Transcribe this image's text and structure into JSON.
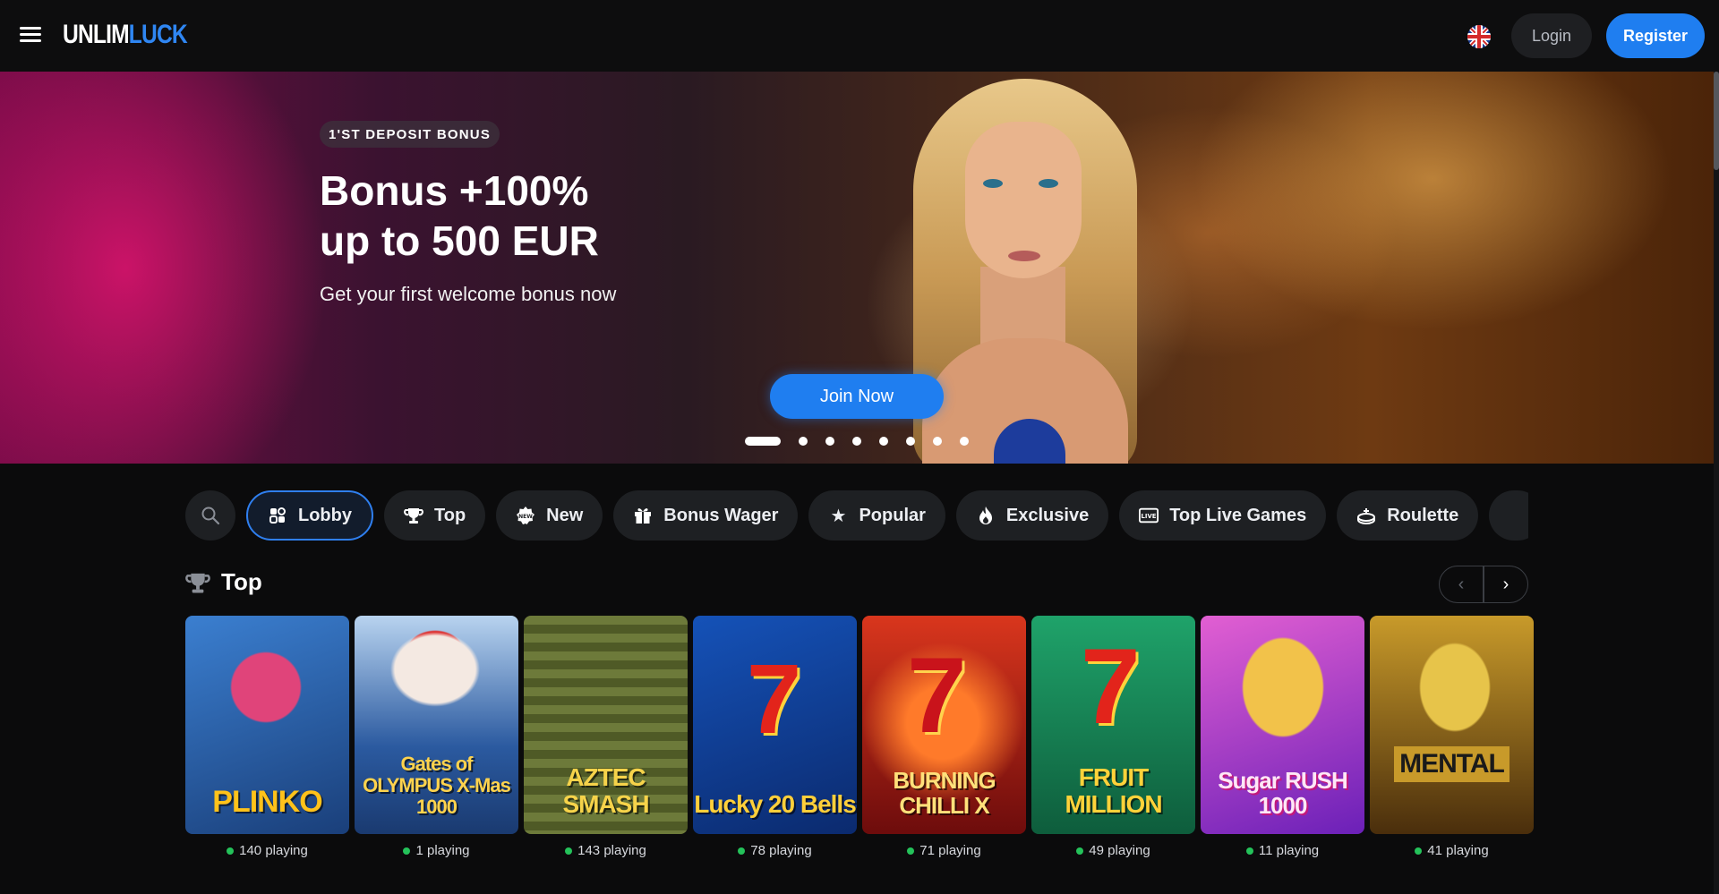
{
  "header": {
    "logo_part1": "UNLIM",
    "logo_part2": "LUCK",
    "login_label": "Login",
    "register_label": "Register",
    "language_icon": "uk-flag-icon"
  },
  "hero": {
    "badge": "1'ST DEPOSIT BONUS",
    "title_line1": "Bonus +100%",
    "title_line2": "up to 500 EUR",
    "subtitle": "Get your first welcome bonus now",
    "cta_label": "Join Now",
    "slide_count": 9,
    "active_slide": 1
  },
  "categories": [
    {
      "label": "Lobby",
      "icon": "lobby-icon",
      "active": true
    },
    {
      "label": "Top",
      "icon": "trophy-icon",
      "active": false
    },
    {
      "label": "New",
      "icon": "new-badge-icon",
      "active": false
    },
    {
      "label": "Bonus Wager",
      "icon": "gift-icon",
      "active": false
    },
    {
      "label": "Popular",
      "icon": "star-icon",
      "active": false
    },
    {
      "label": "Exclusive",
      "icon": "flame-icon",
      "active": false
    },
    {
      "label": "Top Live Games",
      "icon": "live-icon",
      "active": false
    },
    {
      "label": "Roulette",
      "icon": "roulette-icon",
      "active": false
    }
  ],
  "top_section": {
    "title": "Top",
    "icon": "trophy-icon"
  },
  "games": [
    {
      "name": "PLINKO",
      "playing": "140 playing",
      "bg": "#1a3f7a",
      "bg2": "#3b7fd0",
      "text_color": "#ffc21a"
    },
    {
      "name": "Gates of OLYMPUS X-Mas 1000",
      "playing": "1 playing",
      "bg": "#2b5aa0",
      "bg2": "#b8d3ef",
      "text_color": "#ffd34d"
    },
    {
      "name": "AZTEC SMASH",
      "playing": "143 playing",
      "bg": "#2e3a1c",
      "bg2": "#6d7a3a",
      "text_color": "#f6d34a"
    },
    {
      "name": "Lucky 20 Bells",
      "playing": "78 playing",
      "bg": "#0b2a6e",
      "bg2": "#1552b8",
      "text_color": "#ffcf3a"
    },
    {
      "name": "BURNING CHILLI X",
      "playing": "71 playing",
      "bg": "#6d0c0c",
      "bg2": "#d9361d",
      "text_color": "#ffe07a"
    },
    {
      "name": "FRUIT MILLION",
      "playing": "49 playing",
      "bg": "#0e5d3c",
      "bg2": "#1fa36a",
      "text_color": "#ffd23a"
    },
    {
      "name": "Sugar RUSH 1000",
      "playing": "11 playing",
      "bg": "#6b20b8",
      "bg2": "#e25fd2",
      "text_color": "#ffe7f7"
    },
    {
      "name": "MENTAL",
      "playing": "41 playing",
      "bg": "#4a2e0c",
      "bg2": "#c89a2a",
      "text_color": "#1a1a1a"
    }
  ]
}
